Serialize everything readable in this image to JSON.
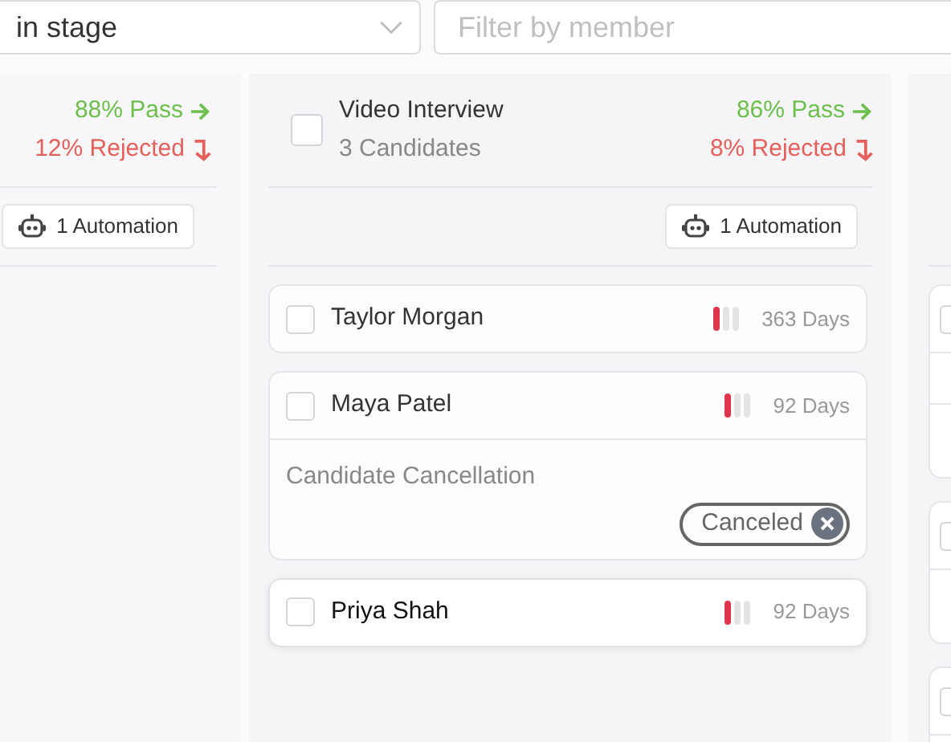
{
  "filters": {
    "stage_select": {
      "value": "in stage"
    },
    "member_filter": {
      "placeholder": "Filter by member"
    }
  },
  "columns": [
    {
      "pass": "88% Pass",
      "rejected": "12% Rejected",
      "automation": "1 Automation"
    },
    {
      "title": "Video Interview",
      "count": "3 Candidates",
      "checked": false,
      "pass": "86% Pass",
      "rejected": "8% Rejected",
      "automation": "1 Automation",
      "cards": [
        {
          "name": "Taylor Morgan",
          "checked": false,
          "level": 0.33,
          "days": "363 Days",
          "highlighted": false
        },
        {
          "name": "Maya Patel",
          "checked": false,
          "level": 0.33,
          "days": "92 Days",
          "highlighted": false,
          "note": "Candidate Cancellation",
          "status": "Canceled"
        },
        {
          "name": "Priya Shah",
          "checked": false,
          "level": 0.33,
          "days": "92 Days",
          "highlighted": true
        }
      ]
    },
    {
      "cards": [
        {
          "kind": "note",
          "checked": false
        },
        {
          "kind": "short_note",
          "checked": false
        },
        {
          "kind": "plain",
          "checked": false
        }
      ]
    }
  ]
}
